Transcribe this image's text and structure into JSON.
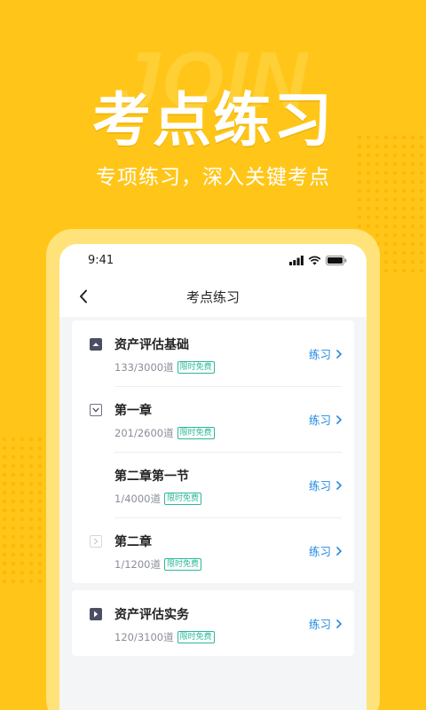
{
  "colors": {
    "background": "#FFC619",
    "accent_blue": "#1E88E5",
    "tag_green": "#2BB89A"
  },
  "hero": {
    "decorative_text": "JOIN",
    "title": "考点练习",
    "subtitle": "专项练习，深入关键考点"
  },
  "status_bar": {
    "time": "9:41",
    "icons": [
      "signal-icon",
      "wifi-icon",
      "battery-icon"
    ]
  },
  "nav": {
    "back_icon": "chevron-left-icon",
    "title": "考点练习"
  },
  "sections": [
    {
      "rows": [
        {
          "title": "资产评估基础",
          "count": "133/3000道",
          "tag": "限时免费",
          "action": "练习",
          "toggle": "collapse-icon"
        },
        {
          "title": "第一章",
          "count": "201/2600道",
          "tag": "限时免费",
          "action": "练习",
          "toggle": "expand-icon"
        },
        {
          "title": "第二章第一节",
          "count": "1/4000道",
          "tag": "限时免费",
          "action": "练习",
          "toggle": ""
        },
        {
          "title": "第二章",
          "count": "1/1200道",
          "tag": "限时免费",
          "action": "练习",
          "toggle": "chevron-right-icon"
        }
      ]
    },
    {
      "rows": [
        {
          "title": "资产评估实务",
          "count": "120/3100道",
          "tag": "限时免费",
          "action": "练习",
          "toggle": "chevron-right-icon"
        }
      ]
    }
  ]
}
